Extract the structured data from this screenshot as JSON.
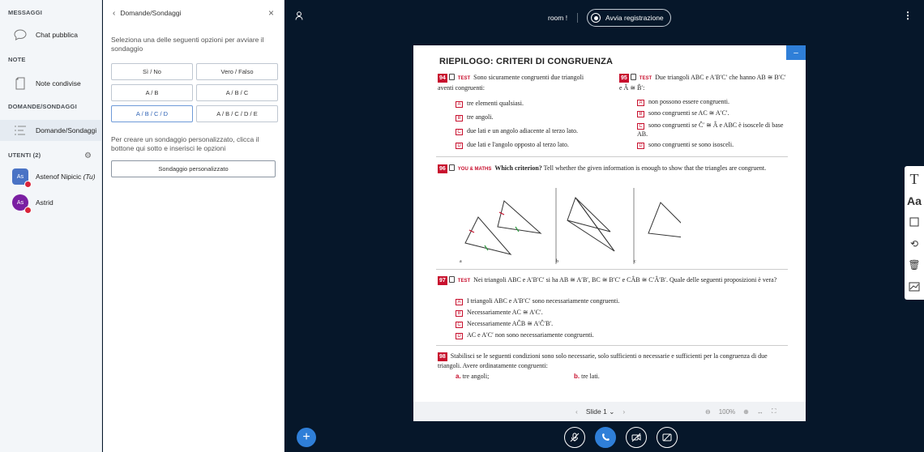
{
  "sidebar": {
    "messages_header": "MESSAGGI",
    "public_chat": "Chat pubblica",
    "notes_header": "NOTE",
    "shared_notes": "Note condivise",
    "polls_header": "DOMANDE/SONDAGGI",
    "polls_item": "Domande/Sondaggi",
    "users_header": "UTENTI (2)",
    "users": [
      {
        "initials": "As",
        "name": "Astenof Nipicic",
        "suffix": "(Tu)"
      },
      {
        "initials": "As",
        "name": "Astrid",
        "suffix": ""
      }
    ]
  },
  "poll": {
    "title": "Domande/Sondaggi",
    "close": "×",
    "description": "Seleziona una delle seguenti opzioni per avviare il sondaggio",
    "options": [
      "Sì / No",
      "Vero / Falso",
      "A / B",
      "A / B / C",
      "A / B / C / D",
      "A / B / C / D / E"
    ],
    "custom_description": "Per creare un sondaggio personalizzato, clicca il bottone qui sotto e inserisci le opzioni",
    "custom_button": "Sondaggio personalizzato"
  },
  "topbar": {
    "room": "room !",
    "record": "Avvia registrazione"
  },
  "slide": {
    "title": "RIEPILOGO: CRITERI DI CONGRUENZA",
    "q94": {
      "num": "94",
      "tag": "TEST",
      "text": "Sono sicuramente congruenti due triangoli aventi congruenti:",
      "answers": [
        [
          "A",
          "tre elementi qualsiasi."
        ],
        [
          "B",
          "tre angoli."
        ],
        [
          "C",
          "due lati e un angolo adiacente al terzo lato."
        ],
        [
          "D",
          "due lati e l'angolo opposto al terzo lato."
        ]
      ]
    },
    "q95": {
      "num": "95",
      "tag": "TEST",
      "text": "Due triangoli ABC e A′B′C′ che hanno AB ≅ B′C′ e Â ≅ B̂′:",
      "answers": [
        [
          "A",
          "non possono essere congruenti."
        ],
        [
          "B",
          "sono congruenti se AC ≅ A′C′."
        ],
        [
          "C",
          "sono congruenti se Ĉ′ ≅ Â e ABC è isoscele di base AB."
        ],
        [
          "D",
          "sono congruenti se sono isosceli."
        ]
      ]
    },
    "q96": {
      "num": "96",
      "tag": "YOU & MATHS",
      "bold": "Which criterion?",
      "text": "Tell whether the given information is enough to show that the triangles are congruent."
    },
    "q97": {
      "num": "97",
      "tag": "TEST",
      "text": "Nei triangoli ABC e A′B′C′ si ha AB ≅ A′B′, BC ≅ B′C′ e CÂB ≅ C′Â′B′. Quale delle seguenti proposizioni è vera?",
      "answers": [
        [
          "A",
          "I triangoli ABC e A′B′C′ sono necessariamente congruenti."
        ],
        [
          "B",
          "Necessariamente AC ≅ A′C′."
        ],
        [
          "C",
          "Necessariamente AĈB ≅ A′Ĉ′B′."
        ],
        [
          "D",
          "AC e A′C′ non sono necessariamente congruenti."
        ]
      ]
    },
    "q98": {
      "num": "98",
      "text": "Stabilisci se le seguenti condizioni sono solo necessarie, solo sufficienti o necessarie e sufficienti per la congruenza di due triangoli. Avere ordinatamente congruenti:",
      "a_lbl": "a.",
      "a": "tre angoli;",
      "b_lbl": "b.",
      "b": "tre lati."
    },
    "fig_labels": [
      "a",
      "b",
      "c"
    ]
  },
  "slide_bar": {
    "slide": "Slide 1",
    "zoom": "100%"
  }
}
